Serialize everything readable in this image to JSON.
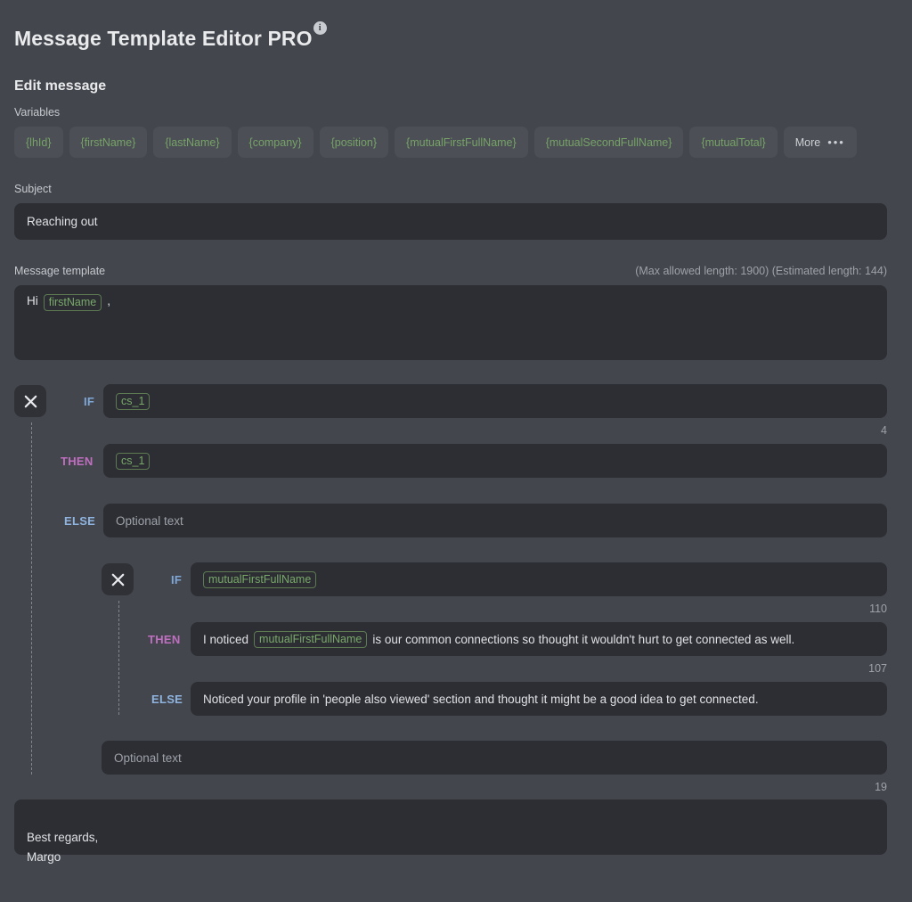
{
  "app": {
    "title": "Message Template Editor PRO",
    "info_icon": "info-icon",
    "section_title": "Edit message"
  },
  "variables": {
    "label": "Variables",
    "chips": [
      "{lhId}",
      "{firstName}",
      "{lastName}",
      "{company}",
      "{position}",
      "{mutualFirstFullName}",
      "{mutualSecondFullName}",
      "{mutualTotal}"
    ],
    "more_label": "More",
    "more_dots": "•••"
  },
  "subject": {
    "label": "Subject",
    "value": "Reaching out",
    "placeholder": "Subject"
  },
  "message_template": {
    "label": "Message template",
    "lengths": "(Max allowed length: 1900) (Estimated length: 144)",
    "max_allowed_length": 1900,
    "estimated_length": 144,
    "greeting_prefix": "Hi",
    "greeting_token": "firstName",
    "greeting_suffix": ","
  },
  "blocks": {
    "outer": {
      "close_label": "×",
      "if_label": "IF",
      "then_label": "THEN",
      "else_label": "ELSE",
      "if_token": "cs_1",
      "then_token": "cs_1",
      "else_placeholder": "Optional text",
      "then_count": "4"
    },
    "inner": {
      "close_label": "×",
      "if_label": "IF",
      "then_label": "THEN",
      "else_label": "ELSE",
      "if_token": "mutualFirstFullName",
      "then_prefix": "I noticed",
      "then_token": "mutualFirstFullName",
      "then_suffix": "is our common connections so thought it wouldn't hurt to get connected as well.",
      "then_count": "110",
      "else_text": "Noticed your profile in 'people also viewed' section and thought it might be a good idea to get connected.",
      "else_count": "107"
    },
    "tail": {
      "placeholder": "Optional text",
      "count": "19"
    }
  },
  "signature": {
    "text": "Best regards,\nMargo"
  },
  "colors": {
    "page_background": "#43464c",
    "field_background": "#2c2e34",
    "chip_background": "#4c4f55",
    "variable_green": "#79a869",
    "keyword_if": "#7fa8d8",
    "keyword_then": "#c06fc0",
    "keyword_else": "#8fb4e0",
    "muted_text": "#9ea2a8"
  }
}
